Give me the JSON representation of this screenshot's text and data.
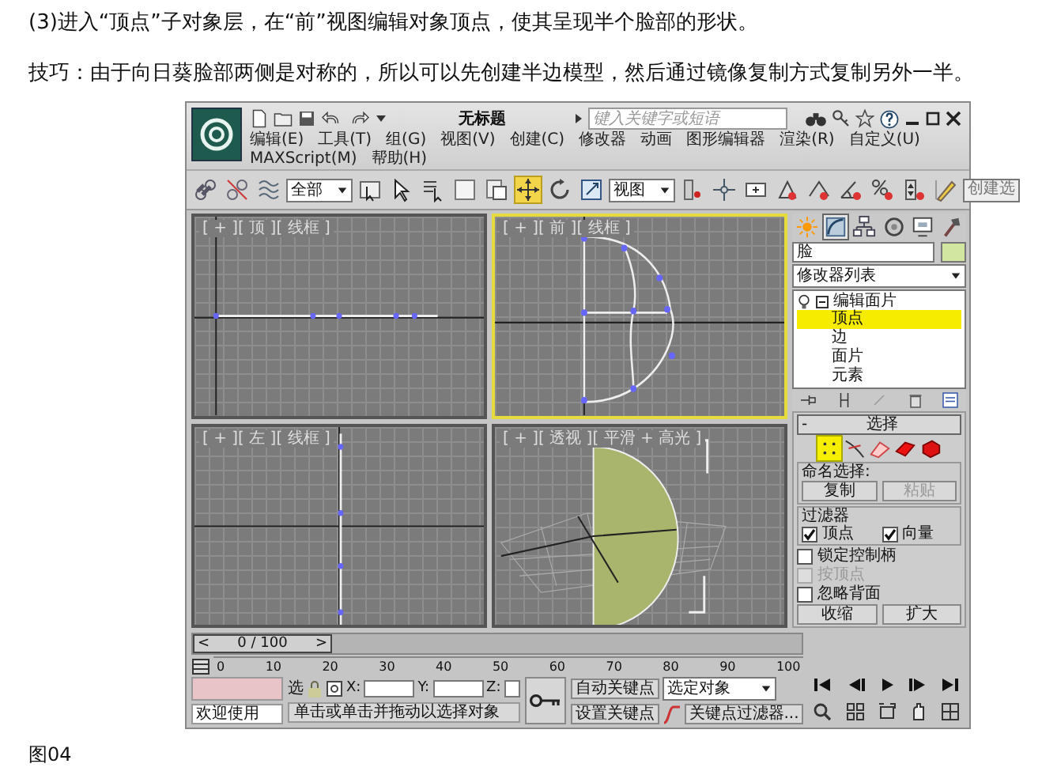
{
  "instructions": [
    {
      "text": "(3)进入“顶点”子对象层，在“前”视图编辑对象顶点，使其呈现半个脸部的形状。"
    },
    {
      "text": "技巧：由于向日葵脸部两侧是对称的，所以可以先创建半边模型，然后通过镜像复制方式复制另外一半。"
    }
  ],
  "app": {
    "title": "无标题",
    "search": {
      "placeholder": "键入关键字或短语"
    },
    "menu": [
      "编辑(E)",
      "工具(T)",
      "组(G)",
      "视图(V)",
      "创建(C)",
      "修改器",
      "动画",
      "图形编辑器",
      "渲染(R)",
      "自定义(U)",
      "MAXScript(M)",
      "帮助(H)"
    ],
    "toolbar": {
      "selection_filter": "全部",
      "reference_coord": "视图",
      "named_selection": "创建选",
      "tools": [
        {
          "kind": "link",
          "active": false
        },
        {
          "kind": "unlink",
          "active": false
        },
        {
          "kind": "bind",
          "active": false
        },
        {
          "kind": "filter",
          "active": false
        },
        {
          "kind": "select",
          "active": false
        },
        {
          "kind": "select-name",
          "active": false
        },
        {
          "kind": "region",
          "active": false
        },
        {
          "kind": "window",
          "active": false
        },
        {
          "kind": "move",
          "active": true
        },
        {
          "kind": "rotate",
          "active": false
        },
        {
          "kind": "scale",
          "active": false
        },
        {
          "kind": "coord",
          "active": false
        },
        {
          "kind": "pivot",
          "active": false
        },
        {
          "kind": "manipulate",
          "active": false
        },
        {
          "kind": "keyboard",
          "active": false
        },
        {
          "kind": "snap",
          "active": false
        },
        {
          "kind": "angle",
          "active": false
        },
        {
          "kind": "percent",
          "active": false
        },
        {
          "kind": "spinner",
          "active": false
        },
        {
          "kind": "edit",
          "active": false
        }
      ]
    },
    "viewports": [
      {
        "kind": "top",
        "label": "[ + ][ 顶 ][ 线框 ]",
        "active": false
      },
      {
        "kind": "front",
        "label": "[ + ][ 前 ][ 线框 ]",
        "active": true
      },
      {
        "kind": "left",
        "label": "[ + ][ 左 ][ 线框 ]",
        "active": false
      },
      {
        "kind": "perspective",
        "label": "[ + ][ 透视 ][ 平滑 + 高光 ]",
        "active": false
      }
    ],
    "command_panel": {
      "tabs": [
        {
          "kind": "create",
          "selected": false
        },
        {
          "kind": "modify",
          "selected": true
        },
        {
          "kind": "hierarchy",
          "selected": false
        },
        {
          "kind": "motion",
          "selected": false
        },
        {
          "kind": "display",
          "selected": false
        },
        {
          "kind": "utilities",
          "selected": false
        }
      ],
      "object_name": "脸",
      "modifier_list": "修改器列表",
      "stack": [
        {
          "label": "编辑面片",
          "expanded": true,
          "children": [
            {
              "label": "顶点",
              "selected": true
            },
            {
              "label": "边",
              "selected": false
            },
            {
              "label": "面片",
              "selected": false
            },
            {
              "label": "元素",
              "selected": false
            }
          ]
        }
      ],
      "rollout": {
        "sign": "-",
        "title": "选择",
        "levels": [
          {
            "kind": "vertex",
            "selected": true
          },
          {
            "kind": "handle",
            "selected": false
          },
          {
            "kind": "edge",
            "selected": false
          },
          {
            "kind": "patch",
            "selected": false
          },
          {
            "kind": "element",
            "selected": false
          }
        ],
        "named_label": "命名选择:",
        "named_buttons": [
          {
            "label": "复制",
            "disabled": false
          },
          {
            "label": "粘贴",
            "disabled": true
          }
        ],
        "filter_label": "过滤器",
        "filters": [
          {
            "label": "顶点",
            "checked": true
          },
          {
            "label": "向量",
            "checked": true
          }
        ],
        "options": [
          {
            "label": "锁定控制柄",
            "checked": false,
            "disabled": false
          },
          {
            "label": "按顶点",
            "checked": false,
            "disabled": true
          },
          {
            "label": "忽略背面",
            "checked": false,
            "disabled": false
          }
        ],
        "buttons": [
          "收缩",
          "扩大"
        ]
      }
    },
    "timeline": {
      "prev": "<",
      "frame": "0 / 100",
      "next": ">",
      "ticks": [
        "0",
        "10",
        "20",
        "30",
        "40",
        "50",
        "60",
        "70",
        "80",
        "90",
        "100"
      ]
    },
    "status": {
      "welcome": "欢迎使用",
      "select_label": "选",
      "x_label": "X:",
      "y_label": "Y:",
      "z_label": "Z:",
      "prompt": "单击或单击并拖动以选择对象",
      "auto_key": "自动关键点",
      "key_mode": "选定对象",
      "set_key": "设置关键点",
      "key_filters": "关键点过滤器..."
    }
  },
  "caption": "图04"
}
